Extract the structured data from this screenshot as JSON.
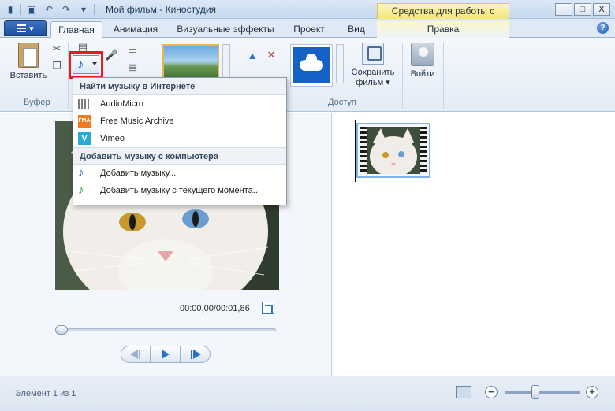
{
  "window": {
    "title": "Мой фильм - Киностудия",
    "context_tab_title": "Средства для работы с видео",
    "controls": {
      "minimize": "−",
      "maximize": "□",
      "close": "X"
    }
  },
  "tabs": [
    {
      "label": "Главная",
      "active": true
    },
    {
      "label": "Анимация"
    },
    {
      "label": "Визуальные эффекты"
    },
    {
      "label": "Проект"
    },
    {
      "label": "Вид"
    },
    {
      "label": "Правка"
    }
  ],
  "help_label": "?",
  "ribbon": {
    "paste_label": "Вставить",
    "clipboard_group": "Буфер",
    "share_group": "Доступ",
    "save_movie_label": "Сохранить фильм",
    "signin_label": "Войти"
  },
  "music_menu": {
    "online_header": "Найти музыку в Интернете",
    "online_items": [
      {
        "label": "AudioMicro",
        "icon": "audiomicro-icon"
      },
      {
        "label": "Free Music Archive",
        "icon": "fma-icon",
        "icon_text": "FMA"
      },
      {
        "label": "Vimeo",
        "icon": "vimeo-icon",
        "icon_text": "V"
      }
    ],
    "local_header": "Добавить музыку с компьютера",
    "local_items": [
      {
        "label": "Добавить музыку...",
        "icon": "music-note-icon"
      },
      {
        "label": "Добавить музыку с текущего момента...",
        "icon": "music-note-add-icon"
      }
    ]
  },
  "preview": {
    "time": "00:00,00/00:01,86",
    "seek_position": 0
  },
  "status": {
    "text": "Элемент 1 из 1",
    "zoom_minus": "−",
    "zoom_plus": "+",
    "zoom_level": 0.4
  },
  "colors": {
    "accent": "#1e5fb4",
    "highlight": "#e02020",
    "context_tab": "#f2e67a"
  }
}
